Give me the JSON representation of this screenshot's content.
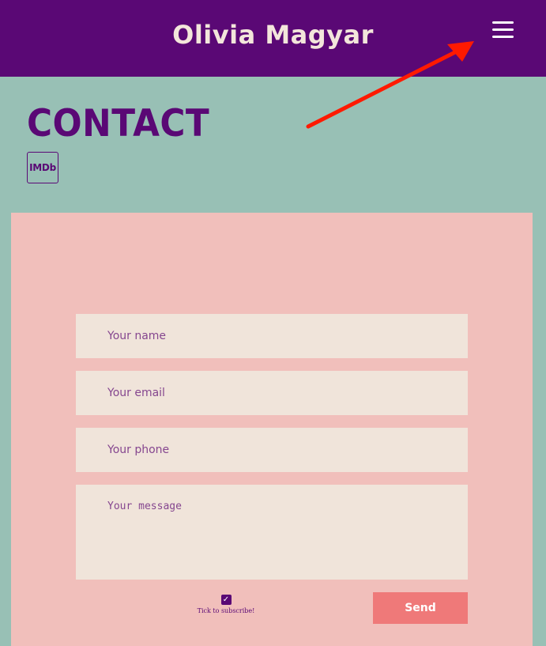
{
  "header": {
    "title": "Olivia Magyar",
    "menu_icon": "hamburger-menu-icon"
  },
  "annotation": {
    "arrow_icon": "red-arrow-annotation",
    "arrow_color": "#ff1a00"
  },
  "main": {
    "heading": "CONTACT",
    "imdb_label": "IMDb"
  },
  "form": {
    "name_placeholder": "Your name",
    "email_placeholder": "Your email",
    "phone_placeholder": "Your phone",
    "message_placeholder": "Your message",
    "subscribe_checked": true,
    "subscribe_label": "Tick to subscribe!",
    "send_label": "Send"
  },
  "colors": {
    "header_bg": "#5a0875",
    "page_bg": "#98c0b5",
    "panel_bg": "#f1bfbb",
    "field_bg": "#f0e4da",
    "button_bg": "#ef7979"
  }
}
